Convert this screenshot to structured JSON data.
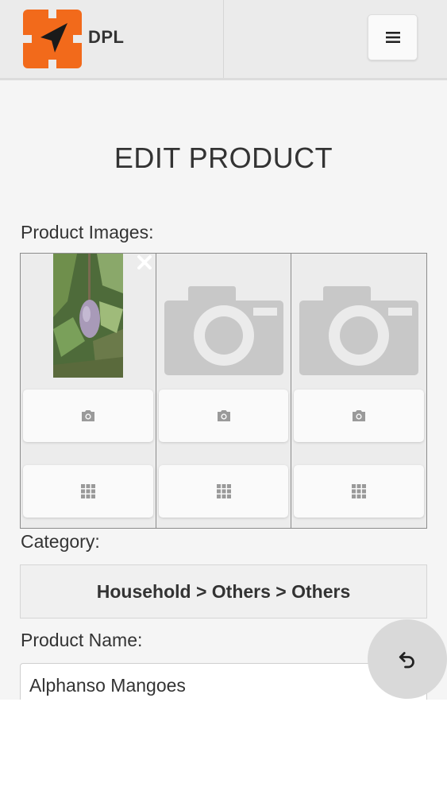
{
  "app": {
    "brand": "DPL"
  },
  "page": {
    "title": "EDIT PRODUCT"
  },
  "labels": {
    "images": "Product Images:",
    "category": "Category:",
    "product_name": "Product Name:"
  },
  "images": [
    {
      "has_photo": true
    },
    {
      "has_photo": false
    },
    {
      "has_photo": false
    }
  ],
  "category": {
    "value": "Household > Others > Others"
  },
  "product_name": {
    "value": "Alphanso Mangoes"
  },
  "icons": {
    "logo": "navigation-arrow-logo",
    "menu": "hamburger-menu-icon",
    "camera": "camera-icon",
    "gallery": "grid-icon",
    "remove": "close-icon",
    "undo": "undo-icon"
  },
  "colors": {
    "brand": "#f26a1b",
    "header_bg": "#ebebeb",
    "placeholder": "#c8c8c8"
  }
}
